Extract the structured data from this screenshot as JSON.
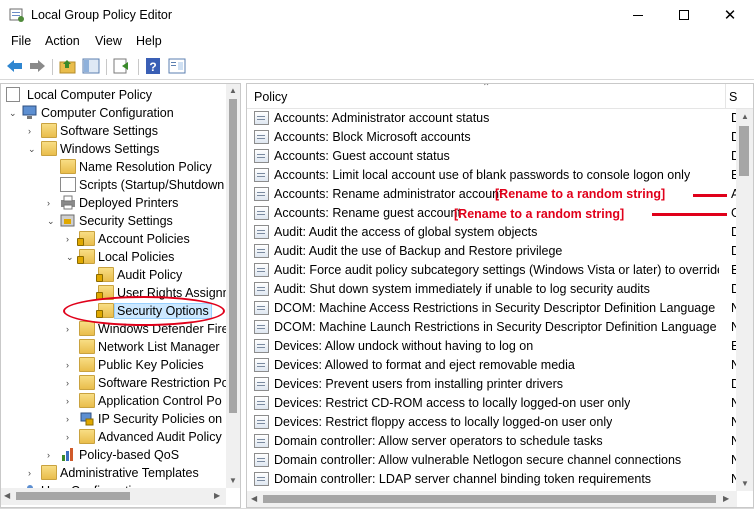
{
  "window": {
    "title": "Local Group Policy Editor",
    "controls": {
      "minimize": "minimize",
      "maximize": "maximize",
      "close": "✕"
    }
  },
  "menu": [
    "File",
    "Action",
    "View",
    "Help"
  ],
  "toolbar": {
    "icons": [
      "back-arrow-icon",
      "forward-arrow-icon",
      "up-folder-icon",
      "show-hide-tree-icon",
      "export-list-icon",
      "help-icon",
      "properties-icon"
    ]
  },
  "tree": {
    "root": "Local Computer Policy",
    "items": [
      {
        "label": "Computer Configuration",
        "expander": "⌄"
      },
      {
        "label": "Software Settings",
        "expander": "›"
      },
      {
        "label": "Windows Settings",
        "expander": "⌄"
      },
      {
        "label": "Name Resolution Policy",
        "expander": ""
      },
      {
        "label": "Scripts (Startup/Shutdown",
        "expander": ""
      },
      {
        "label": "Deployed Printers",
        "expander": "›"
      },
      {
        "label": "Security Settings",
        "expander": "⌄"
      },
      {
        "label": "Account Policies",
        "expander": "›"
      },
      {
        "label": "Local Policies",
        "expander": "⌄"
      },
      {
        "label": "Audit Policy",
        "expander": ""
      },
      {
        "label": "User Rights Assignm",
        "expander": ""
      },
      {
        "label": "Security Options",
        "expander": ""
      },
      {
        "label": "Windows Defender Fire",
        "expander": "›"
      },
      {
        "label": "Network List Manager",
        "expander": ""
      },
      {
        "label": "Public Key Policies",
        "expander": "›"
      },
      {
        "label": "Software Restriction Po",
        "expander": "›"
      },
      {
        "label": "Application Control Po",
        "expander": "›"
      },
      {
        "label": "IP Security Policies on",
        "expander": "›"
      },
      {
        "label": "Advanced Audit Policy",
        "expander": "›"
      },
      {
        "label": "Policy-based QoS",
        "expander": "›"
      },
      {
        "label": "Administrative Templates",
        "expander": "›"
      },
      {
        "label": "User Configuration",
        "expander": "⌄"
      }
    ]
  },
  "list": {
    "column_policy": "Policy",
    "column_setting": "S",
    "rows": [
      {
        "name": "Accounts: Administrator account status",
        "value": "D"
      },
      {
        "name": "Accounts: Block Microsoft accounts",
        "value": "D"
      },
      {
        "name": "Accounts: Guest account status",
        "value": "D"
      },
      {
        "name": "Accounts: Limit local account use of blank passwords to console logon only",
        "value": "E"
      },
      {
        "name": "Accounts: Rename administrator account",
        "value": "A"
      },
      {
        "name": "Accounts: Rename guest account",
        "value": "G"
      },
      {
        "name": "Audit: Audit the access of global system objects",
        "value": "D"
      },
      {
        "name": "Audit: Audit the use of Backup and Restore privilege",
        "value": "D"
      },
      {
        "name": "Audit: Force audit policy subcategory settings (Windows Vista or later) to override a...",
        "value": "E"
      },
      {
        "name": "Audit: Shut down system immediately if unable to log security audits",
        "value": "D"
      },
      {
        "name": "DCOM: Machine Access Restrictions in Security Descriptor Definition Language (SD...",
        "value": "N"
      },
      {
        "name": "DCOM: Machine Launch Restrictions in Security Descriptor Definition Language (SD...",
        "value": "N"
      },
      {
        "name": "Devices: Allow undock without having to log on",
        "value": "E"
      },
      {
        "name": "Devices: Allowed to format and eject removable media",
        "value": "N"
      },
      {
        "name": "Devices: Prevent users from installing printer drivers",
        "value": "D"
      },
      {
        "name": "Devices: Restrict CD-ROM access to locally logged-on user only",
        "value": "N"
      },
      {
        "name": "Devices: Restrict floppy access to locally logged-on user only",
        "value": "N"
      },
      {
        "name": "Domain controller: Allow server operators to schedule tasks",
        "value": "N"
      },
      {
        "name": "Domain controller: Allow vulnerable Netlogon secure channel connections",
        "value": "N"
      },
      {
        "name": "Domain controller: LDAP server channel binding token requirements",
        "value": "N"
      }
    ]
  },
  "annotations": {
    "rename_admin": "[Rename to a random string]",
    "rename_guest": "[Rename to a random string]"
  },
  "colors": {
    "annotation": "#e0001a",
    "selection": "#cce8ff",
    "folder": "#e9bd4c"
  }
}
